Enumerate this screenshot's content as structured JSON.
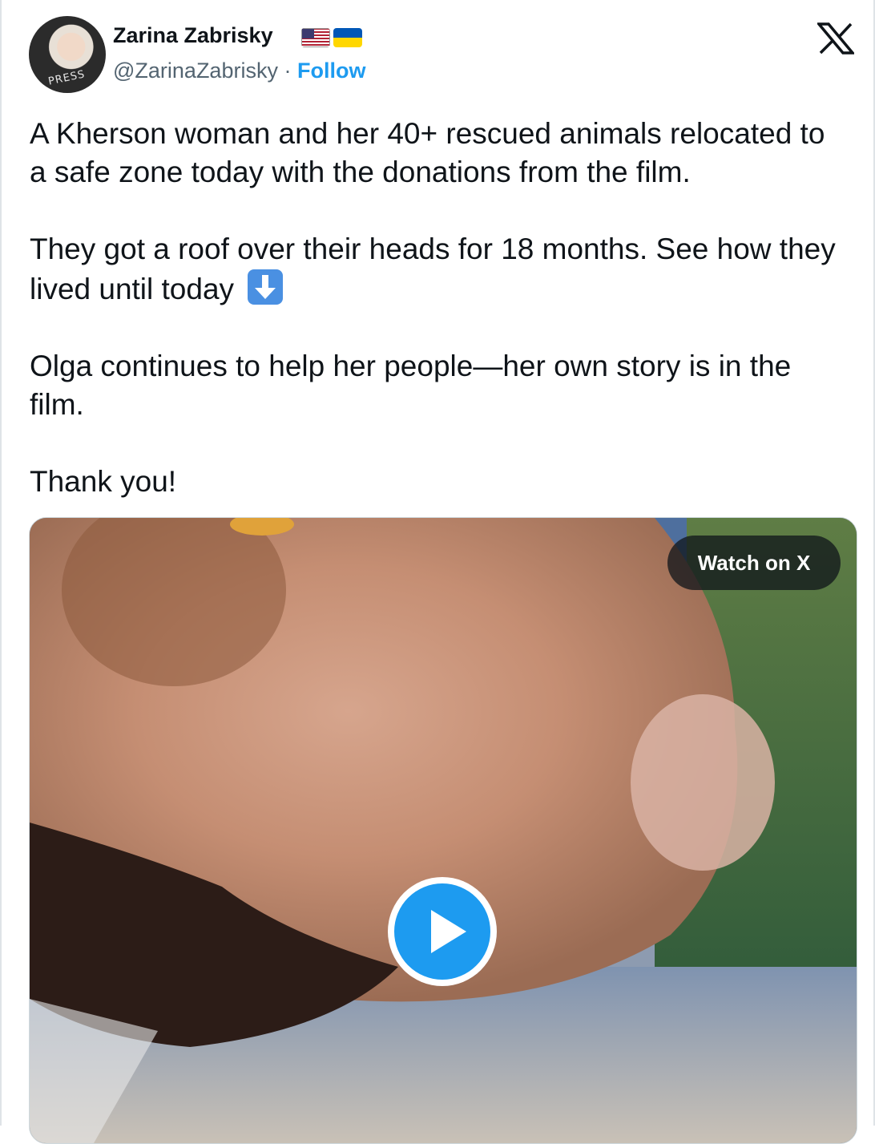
{
  "author": {
    "name": "Zarina Zabrisky",
    "handle": "@ZarinaZabrisky",
    "separator": "·",
    "follow_label": "Follow",
    "avatar_text": "PRESS"
  },
  "platform": {
    "logo": "x-logo-icon"
  },
  "tweet": {
    "paragraphs": [
      "A Kherson woman and her 40+ rescued animals relocated to a safe zone today with the donations from the film.",
      "They got a roof over their heads for 18 months. See how they lived until today",
      "Olga continues to help her people—her own story is in the film.",
      "Thank you!"
    ],
    "emoji": "down-arrow-emoji-icon"
  },
  "media": {
    "watch_label": "Watch on X",
    "play_icon": "play-icon"
  },
  "colors": {
    "accent": "#1d9bf0",
    "text": "#0f1419",
    "secondary": "#536471"
  }
}
